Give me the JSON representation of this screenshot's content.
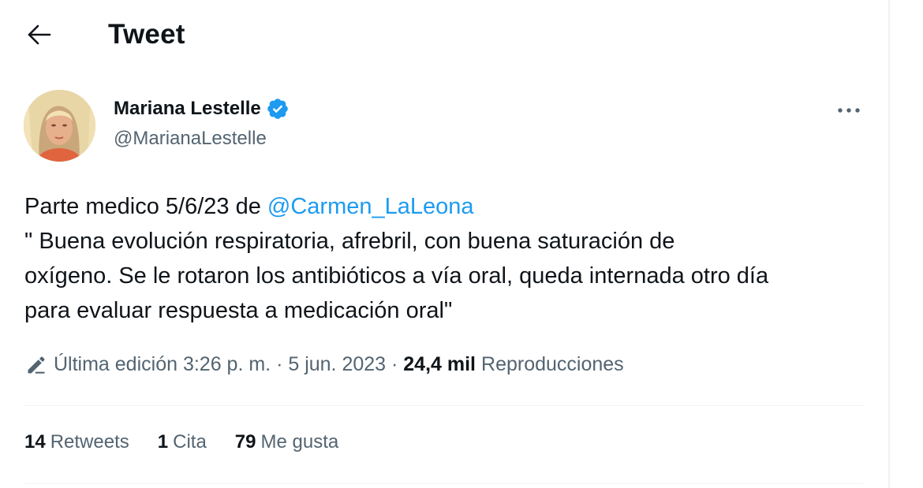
{
  "header": {
    "title": "Tweet"
  },
  "user": {
    "name": "Mariana Lestelle",
    "handle": "@MarianaLestelle",
    "verified": true
  },
  "tweet": {
    "line1_prefix": "Parte medico 5/6/23 de ",
    "mention": "@Carmen_LaLeona",
    "line2": "\" Buena evolución respiratoria, afrebril, con buena saturación de",
    "line3": "oxígeno. Se le rotaron los antibióticos a vía oral, queda internada otro día",
    "line4": "para evaluar respuesta a medicación oral\""
  },
  "meta": {
    "edited_label": "Última edición 3:26 p. m.",
    "separator1": " · ",
    "date": "5 jun. 2023",
    "separator2": " · ",
    "views_count": "24,4 mil",
    "views_label": "Reproducciones"
  },
  "stats": [
    {
      "count": "14",
      "label": "Retweets"
    },
    {
      "count": "1",
      "label": "Cita"
    },
    {
      "count": "79",
      "label": "Me gusta"
    }
  ],
  "colors": {
    "accent": "#1d9bf0",
    "text": "#0f1419",
    "secondary": "#536471",
    "divider": "#eff3f4"
  },
  "icons": {
    "back": "arrow-left-icon",
    "verified": "verified-badge-icon",
    "more": "more-dots-icon",
    "edit": "pencil-icon"
  }
}
